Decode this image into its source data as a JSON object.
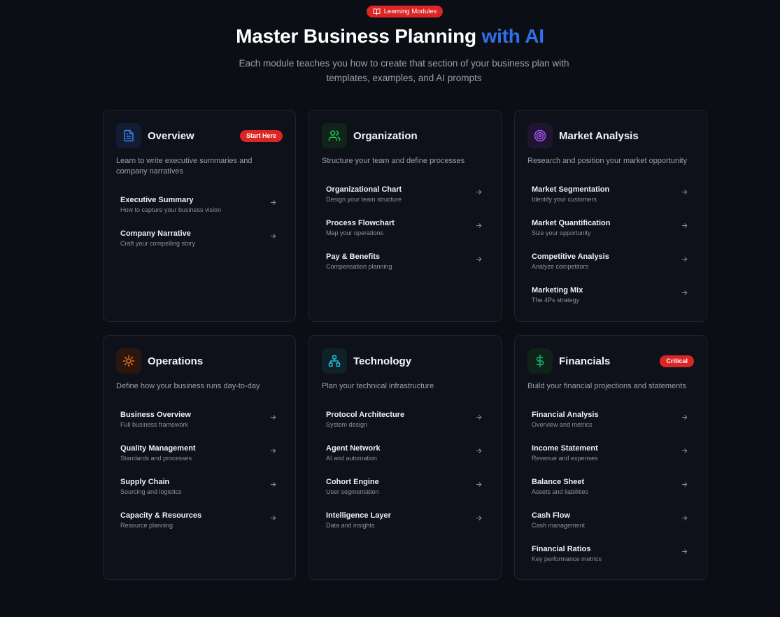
{
  "header": {
    "pill_label": "Learning Modules",
    "pill_icon": "book-open-icon",
    "title_main": "Master Business Planning",
    "title_accent": "with AI",
    "subtitle": "Each module teaches you how to create that section of your business plan with templates, examples, and AI prompts"
  },
  "colors": {
    "background": "#0b0e14",
    "accent": "#2f6fe8",
    "badge": "#dc2626"
  },
  "modules": [
    {
      "title": "Overview",
      "icon": "document-icon",
      "badge": "Start Here",
      "description": "Learn to write executive summaries and company narratives",
      "items": [
        {
          "title": "Executive Summary",
          "subtitle": "How to capture your business vision"
        },
        {
          "title": "Company Narrative",
          "subtitle": "Craft your compelling story"
        }
      ]
    },
    {
      "title": "Organization",
      "icon": "users-icon",
      "description": "Structure your team and define processes",
      "items": [
        {
          "title": "Organizational Chart",
          "subtitle": "Design your team structure"
        },
        {
          "title": "Process Flowchart",
          "subtitle": "Map your operations"
        },
        {
          "title": "Pay & Benefits",
          "subtitle": "Compensation planning"
        }
      ]
    },
    {
      "title": "Market Analysis",
      "icon": "target-icon",
      "description": "Research and position your market opportunity",
      "items": [
        {
          "title": "Market Segmentation",
          "subtitle": "Identify your customers"
        },
        {
          "title": "Market Quantification",
          "subtitle": "Size your opportunity"
        },
        {
          "title": "Competitive Analysis",
          "subtitle": "Analyze competitors"
        },
        {
          "title": "Marketing Mix",
          "subtitle": "The 4Ps strategy"
        }
      ]
    },
    {
      "title": "Operations",
      "icon": "cog-icon",
      "description": "Define how your business runs day-to-day",
      "items": [
        {
          "title": "Business Overview",
          "subtitle": "Full business framework"
        },
        {
          "title": "Quality Management",
          "subtitle": "Standards and processes"
        },
        {
          "title": "Supply Chain",
          "subtitle": "Sourcing and logistics"
        },
        {
          "title": "Capacity & Resources",
          "subtitle": "Resource planning"
        }
      ]
    },
    {
      "title": "Technology",
      "icon": "network-icon",
      "description": "Plan your technical infrastructure",
      "items": [
        {
          "title": "Protocol Architecture",
          "subtitle": "System design"
        },
        {
          "title": "Agent Network",
          "subtitle": "AI and automation"
        },
        {
          "title": "Cohort Engine",
          "subtitle": "User segmentation"
        },
        {
          "title": "Intelligence Layer",
          "subtitle": "Data and insights"
        }
      ]
    },
    {
      "title": "Financials",
      "icon": "dollar-icon",
      "badge": "Critical",
      "description": "Build your financial projections and statements",
      "items": [
        {
          "title": "Financial Analysis",
          "subtitle": "Overview and metrics"
        },
        {
          "title": "Income Statement",
          "subtitle": "Revenue and expenses"
        },
        {
          "title": "Balance Sheet",
          "subtitle": "Assets and liabilities"
        },
        {
          "title": "Cash Flow",
          "subtitle": "Cash management"
        },
        {
          "title": "Financial Ratios",
          "subtitle": "Key performance metrics"
        }
      ]
    }
  ]
}
